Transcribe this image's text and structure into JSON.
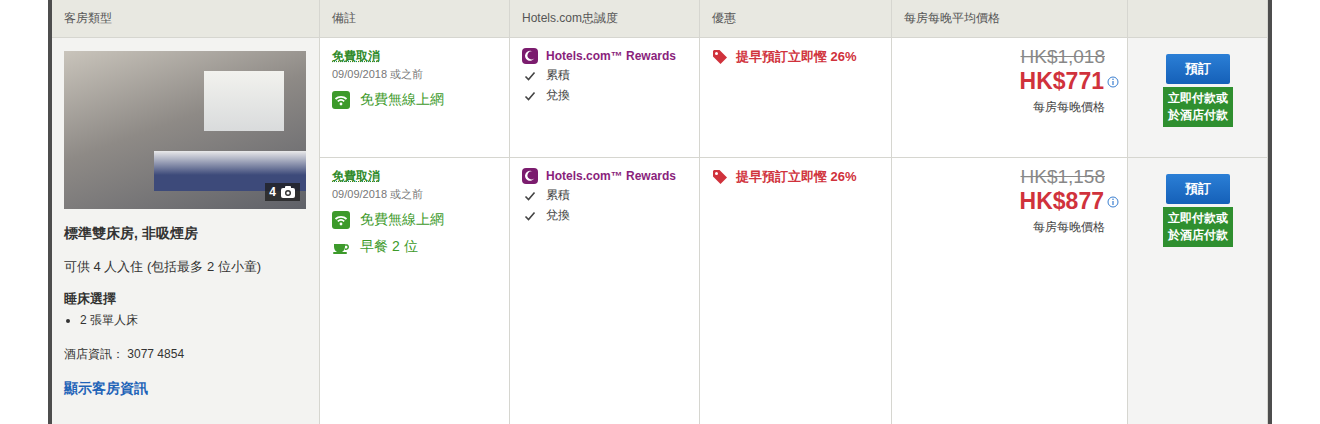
{
  "columns": [
    "客房類型",
    "備註",
    "Hotels.com忠誠度",
    "優惠",
    "每房每晚平均價格"
  ],
  "room": {
    "photo_count": "4",
    "name": "標準雙床房, 非吸煙房",
    "capacity": "可供 4 人入住 (包括最多 2 位小童)",
    "bed_title": "睡床選擇",
    "beds": [
      "2 張單人床"
    ],
    "info": "酒店資訊： 3077 4854",
    "link": "顯示客房資訊"
  },
  "rates": [
    {
      "cancel": "免費取消",
      "cancel_date": "09/09/2018 或之前",
      "amenities": [
        {
          "kind": "wifi",
          "label": "免費無線上網"
        }
      ],
      "rewards": {
        "title": "Hotels.com™ Rewards",
        "items": [
          "累積",
          "兌換"
        ]
      },
      "deal": "提早預訂立即慳 26%",
      "old_price": "HK$1,018",
      "price": "HK$771",
      "price_note": "每房每晚價格",
      "book": "預訂",
      "pay": "立即付款或於酒店付款"
    },
    {
      "cancel": "免費取消",
      "cancel_date": "09/09/2018 或之前",
      "amenities": [
        {
          "kind": "wifi",
          "label": "免費無線上網"
        },
        {
          "kind": "breakfast",
          "label": "早餐 2 位"
        }
      ],
      "rewards": {
        "title": "Hotels.com™ Rewards",
        "items": [
          "累積",
          "兌換"
        ]
      },
      "deal": "提早預訂立即慳 26%",
      "old_price": "HK$1,158",
      "price": "HK$877",
      "price_note": "每房每晚價格",
      "book": "預訂",
      "pay": "立即付款或於酒店付款"
    }
  ]
}
